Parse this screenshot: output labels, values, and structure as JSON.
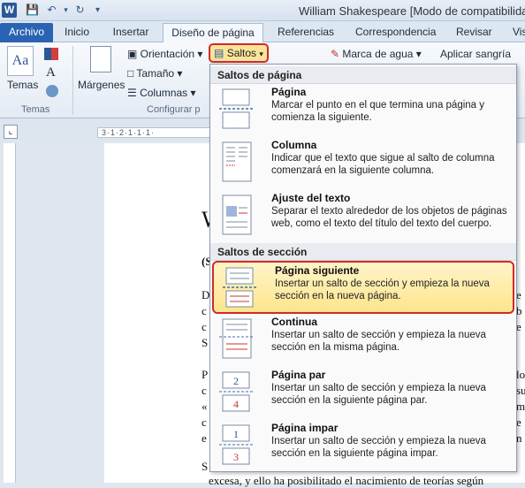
{
  "window": {
    "title": "William Shakespeare [Modo de compatibilidad]"
  },
  "tabs": [
    "Archivo",
    "Inicio",
    "Insertar",
    "Diseño de página",
    "Referencias",
    "Correspondencia",
    "Revisar",
    "Vis"
  ],
  "ribbon": {
    "temas": {
      "button": "Temas",
      "group": "Temas"
    },
    "configurar": {
      "margenes": "Márgenes",
      "orientacion": "Orientación",
      "tamano": "Tamaño",
      "columnas": "Columnas",
      "saltos": "Saltos",
      "group": "Configurar p"
    },
    "marca_agua": "Marca de agua",
    "aplicar_sangria": "Aplicar sangría"
  },
  "ruler": {
    "ticks": "3·1·2·1·1·1·"
  },
  "document": {
    "heading_frag": "W",
    "sub_frag": "(S",
    "left_letters": [
      "D",
      "c",
      "c",
      "S",
      "P",
      "c",
      "«",
      "c",
      "e",
      "S"
    ],
    "right_letters": [
      "e",
      "b",
      "e",
      "lo",
      "su",
      "ml",
      "e",
      "n"
    ],
    "bottom_line": "excesa, y ello ha posibilitado el nacimiento de teorías según"
  },
  "menu": {
    "section1": "Saltos de página",
    "section2": "Saltos de sección",
    "items": [
      {
        "title": "Página",
        "desc": "Marcar el punto en el que termina una página y comienza la siguiente."
      },
      {
        "title": "Columna",
        "desc": "Indicar que el texto que sigue al salto de columna comenzará en la siguiente columna."
      },
      {
        "title": "Ajuste del texto",
        "desc": "Separar el texto alrededor de los objetos de páginas web, como el texto del título del texto del cuerpo."
      },
      {
        "title": "Página siguiente",
        "desc": "Insertar un salto de sección y empieza la nueva sección en la nueva página."
      },
      {
        "title": "Continua",
        "desc": "Insertar un salto de sección y empieza la nueva sección en la misma página."
      },
      {
        "title": "Página par",
        "desc": "Insertar un salto de sección y empieza la nueva sección en la siguiente página par."
      },
      {
        "title": "Página impar",
        "desc": "Insertar un salto de sección y empieza la nueva sección en la siguiente página impar."
      }
    ],
    "page_numbers": {
      "par_top": "2",
      "par_bottom": "4",
      "impar_top": "1",
      "impar_bottom": "3"
    }
  },
  "colors": {
    "highlight_border": "#d02a2a",
    "highlight_fill": "#fde58c",
    "archivo_tab": "#2b63b3"
  }
}
